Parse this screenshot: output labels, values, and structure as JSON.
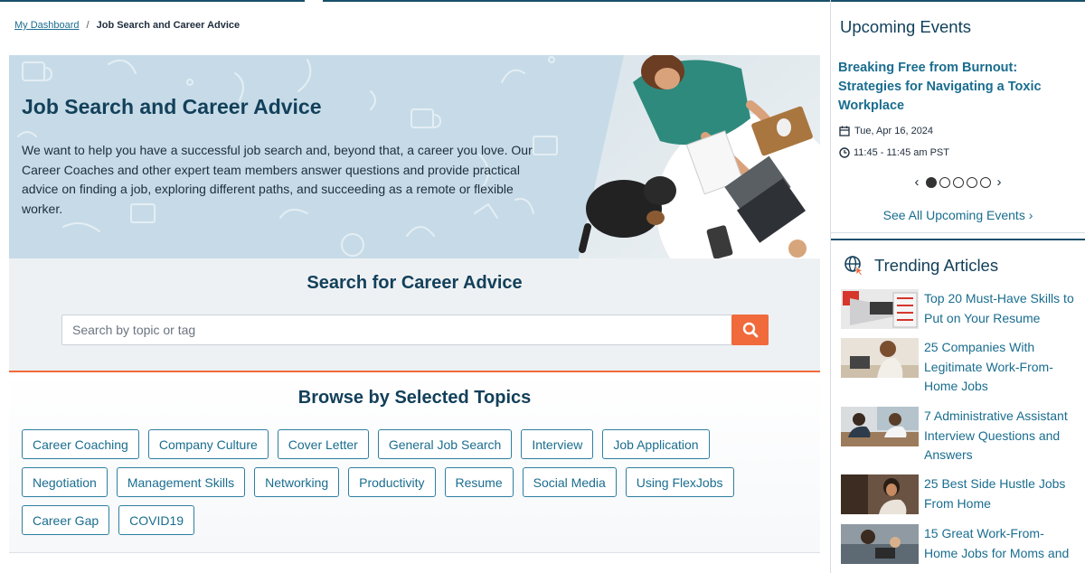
{
  "breadcrumb": {
    "home": "My Dashboard",
    "separator": "/",
    "current": "Job Search and Career Advice"
  },
  "hero": {
    "title": "Job Search and Career Advice",
    "text": "We want to help you have a successful job search and, beyond that, a career you love. Our Career Coaches and other expert team members answer questions and provide practical advice on finding a job, exploring different paths, and succeeding as a remote or flexible worker."
  },
  "search": {
    "heading": "Search for Career Advice",
    "placeholder": "Search by topic or tag"
  },
  "browse": {
    "heading": "Browse by Selected Topics",
    "rows": [
      [
        "Career Coaching",
        "Company Culture",
        "Cover Letter",
        "General Job Search",
        "Interview",
        "Job Application"
      ],
      [
        "Negotiation",
        "Management Skills",
        "Networking",
        "Productivity",
        "Resume",
        "Social Media",
        "Using FlexJobs"
      ],
      [
        "Career Gap",
        "COVID19"
      ]
    ]
  },
  "events": {
    "heading": "Upcoming Events",
    "title": "Breaking Free from Burnout: Strategies for Navigating a Toxic Workplace",
    "date": "Tue, Apr 16, 2024",
    "time": "11:45 - 11:45 am PST",
    "carousel_prev": "‹",
    "carousel_next": "›",
    "carousel_count": 5,
    "carousel_active": 1,
    "see_all": "See All Upcoming Events ›"
  },
  "trending": {
    "heading": "Trending Articles",
    "articles": [
      {
        "title": "Top 20 Must-Have Skills to Put on Your Resume",
        "icon": "skills-thumbnail"
      },
      {
        "title": "25 Companies With Legitimate Work-From-Home Jobs",
        "icon": "woman-laptop-thumbnail"
      },
      {
        "title": "7 Administrative Assistant Interview Questions and Answers",
        "icon": "interview-thumbnail"
      },
      {
        "title": "25 Best Side Hustle Jobs From Home",
        "icon": "woman-desk-thumbnail"
      },
      {
        "title": "15 Great Work-From-Home Jobs for Moms and",
        "icon": "mom-laptop-thumbnail"
      }
    ]
  },
  "colors": {
    "brand_dark": "#13405a",
    "link": "#1a6d8f",
    "accent": "#f06a3b",
    "hero_bg": "#c6dbe7"
  }
}
